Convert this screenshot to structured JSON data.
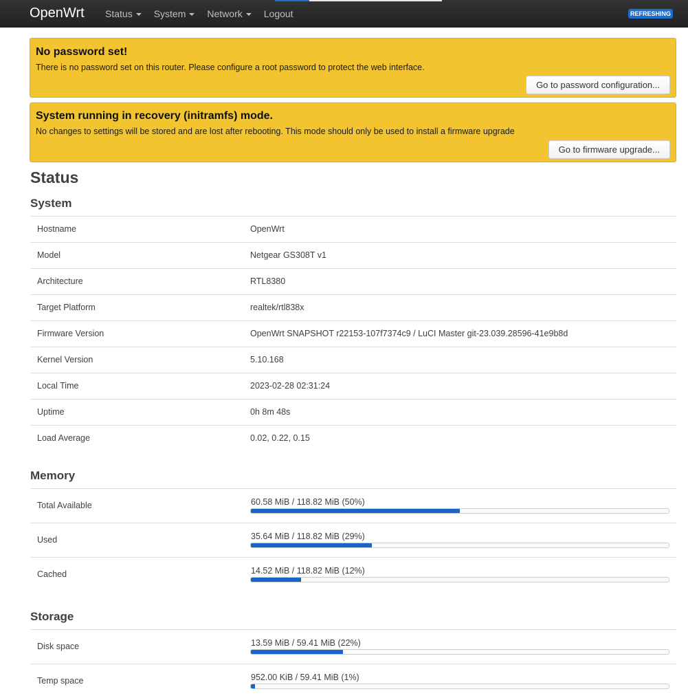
{
  "header": {
    "brand": "OpenWrt",
    "menu": [
      {
        "label": "Status",
        "dropdown": true
      },
      {
        "label": "System",
        "dropdown": true
      },
      {
        "label": "Network",
        "dropdown": true
      },
      {
        "label": "Logout",
        "dropdown": false
      }
    ],
    "badge": "REFRESHING"
  },
  "alerts": [
    {
      "title": "No password set!",
      "text": "There is no password set on this router. Please configure a root password to protect the web interface.",
      "button": "Go to password configuration..."
    },
    {
      "title": "System running in recovery (initramfs) mode.",
      "text": "No changes to settings will be stored and are lost after rebooting. This mode should only be used to install a firmware upgrade",
      "button": "Go to firmware upgrade..."
    }
  ],
  "page_title": "Status",
  "system": {
    "title": "System",
    "rows": [
      {
        "key": "Hostname",
        "value": "OpenWrt"
      },
      {
        "key": "Model",
        "value": "Netgear GS308T v1"
      },
      {
        "key": "Architecture",
        "value": "RTL8380"
      },
      {
        "key": "Target Platform",
        "value": "realtek/rtl838x"
      },
      {
        "key": "Firmware Version",
        "value": "OpenWrt SNAPSHOT r22153-107f7374c9 / LuCI Master git-23.039.28596-41e9b8d"
      },
      {
        "key": "Kernel Version",
        "value": "5.10.168"
      },
      {
        "key": "Local Time",
        "value": "2023-02-28 02:31:24"
      },
      {
        "key": "Uptime",
        "value": "0h 8m 48s"
      },
      {
        "key": "Load Average",
        "value": "0.02, 0.22, 0.15"
      }
    ]
  },
  "memory": {
    "title": "Memory",
    "rows": [
      {
        "key": "Total Available",
        "label": "60.58 MiB / 118.82 MiB (50%)",
        "percent": 50
      },
      {
        "key": "Used",
        "label": "35.64 MiB / 118.82 MiB (29%)",
        "percent": 29
      },
      {
        "key": "Cached",
        "label": "14.52 MiB / 118.82 MiB (12%)",
        "percent": 12
      }
    ]
  },
  "storage": {
    "title": "Storage",
    "rows": [
      {
        "key": "Disk space",
        "label": "13.59 MiB / 59.41 MiB (22%)",
        "percent": 22
      },
      {
        "key": "Temp space",
        "label": "952.00 KiB / 59.41 MiB (1%)",
        "percent": 1
      }
    ]
  },
  "colors": {
    "navbar": "#222222",
    "alert_warning": "#f2c430",
    "progress_fill": "#1a63c7",
    "badge": "#1a6fd1"
  }
}
